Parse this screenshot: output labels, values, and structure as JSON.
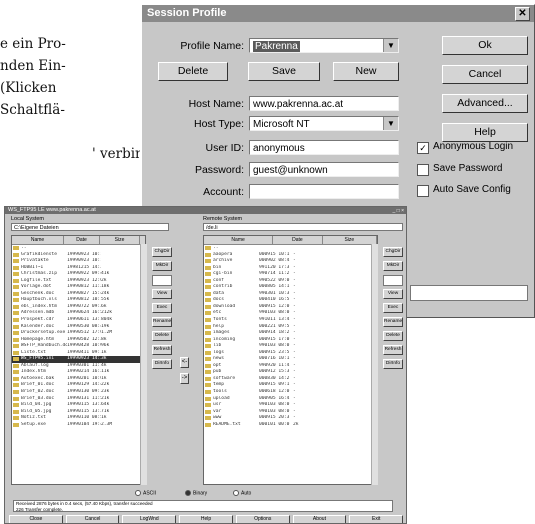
{
  "bg_text": {
    "lines": [
      "e ein Pro-",
      "nden Ein-",
      "(Klicken",
      "Schaltflä-",
      "' verbin-"
    ]
  },
  "session_profile": {
    "title": "Session Profile",
    "close_glyph": "✕",
    "profile_name": {
      "label": "Profile Name:",
      "value": "Pakrenna"
    },
    "delete_label": "Delete",
    "save_label": "Save",
    "new_label": "New",
    "host_name": {
      "label": "Host Name:",
      "value": "www.pakrenna.ac.at"
    },
    "host_type": {
      "label": "Host Type:",
      "value": "Microsoft NT"
    },
    "user_id": {
      "label": "User ID:",
      "value": "anonymous"
    },
    "password": {
      "label": "Password:",
      "value": "guest@unknown"
    },
    "account": {
      "label": "Account:",
      "value": ""
    },
    "ok_label": "Ok",
    "cancel_label": "Cancel",
    "advanced_label": "Advanced...",
    "help_label": "Help",
    "anon_login": {
      "label": "Anonymous Login",
      "checked": true
    },
    "save_password": {
      "label": "Save Password",
      "checked": false
    },
    "auto_save": {
      "label": "Auto Save Config",
      "checked": false
    }
  },
  "ftp": {
    "title": "WS_FTP95 LE www.pakrenna.ac.at",
    "window_controls": "_ □ ×",
    "local_label": "Local System",
    "remote_label": "Remote System",
    "local_path": "C:\\Eigene Dateien",
    "remote_path": "/de.li",
    "headers": [
      "Name",
      "Date",
      "Size"
    ],
    "remote_headers": [
      "Name",
      "Date",
      "Size"
    ],
    "local_files": [
      [
        "..",
        "",
        ""
      ],
      [
        "Grafikdienste",
        "19990923 10:12",
        ""
      ],
      [
        "Privatakte",
        "19990923 10:14",
        ""
      ],
      [
        "HOBBIT~1",
        "19981215 14:33",
        ""
      ],
      [
        "Christmas.zip",
        "19990922 09:45",
        "41k"
      ],
      [
        "Logfile.txt",
        "19990923 12:02",
        "2k"
      ],
      [
        "Vorlage.dot",
        "19990812 11:20",
        "18k"
      ],
      [
        "Geschenk.doc",
        "19990827 15:44",
        "24k"
      ],
      [
        "Hauptbuch.xls",
        "19990812 10:18",
        "55k"
      ],
      [
        "ebl_index.htm",
        "19990722 09:31",
        "6k"
      ],
      [
        "Adressen.mdb",
        "19990624 16:50",
        "212k"
      ],
      [
        "Prospekt.cdr",
        "19990611 13:12",
        "804k"
      ],
      [
        "Kalender.doc",
        "19990530 08:44",
        "19k"
      ],
      [
        "Druckersetup.exe",
        "19990512 17:01",
        "1.2M"
      ],
      [
        "Homepage.htm",
        "19990502 12:33",
        "8k"
      ],
      [
        "WSFTP_Handbuch.doc",
        "19990428 10:05",
        "96k"
      ],
      [
        "Liste.txt",
        "19990411 09:12",
        "1k"
      ],
      [
        "WS_FTP95.ini",
        "19990923 14:22",
        "3k"
      ],
      [
        "Ablauf.log",
        "19990301 11:11",
        "4k"
      ],
      [
        "Index.htm",
        "19990214 16:29",
        "11k"
      ],
      [
        "Autoexec.bak",
        "19990201 10:00",
        "1k"
      ],
      [
        "Brief_01.doc",
        "19990129 14:45",
        "22k"
      ],
      [
        "Brief_02.doc",
        "19990130 09:18",
        "23k"
      ],
      [
        "Brief_03.doc",
        "19990131 11:50",
        "21k"
      ],
      [
        "Bild_04.jpg",
        "19990115 13:20",
        "64k"
      ],
      [
        "Bild_05.jpg",
        "19990115 13:24",
        "71k"
      ],
      [
        "Notiz.txt",
        "19990110 08:55",
        "1k"
      ],
      [
        "Setup.exe",
        "19990104 19:42",
        "2.3M"
      ]
    ],
    "local_highlight": 17,
    "remote_files": [
      [
        "..",
        "",
        ""
      ],
      [
        "aaopera",
        "000915 10:1",
        "-"
      ],
      [
        "archive",
        "000902 08:4",
        "-"
      ],
      [
        "bin",
        "991120 17:3",
        "-"
      ],
      [
        "cgi-bin",
        "990714 11:2",
        "-"
      ],
      [
        "conf",
        "990522 09:0",
        "-"
      ],
      [
        "contrib",
        "000805 14:1",
        "-"
      ],
      [
        "data",
        "990301 10:3",
        "-"
      ],
      [
        "docs",
        "000410 16:5",
        "-"
      ],
      [
        "download",
        "000915 12:0",
        "-"
      ],
      [
        "etc",
        "990103 08:0",
        "-"
      ],
      [
        "fonts",
        "991011 13:4",
        "-"
      ],
      [
        "help",
        "000221 09:5",
        "-"
      ],
      [
        "images",
        "000914 18:2",
        "-"
      ],
      [
        "incoming",
        "000915 17:0",
        "-"
      ],
      [
        "lib",
        "990103 08:0",
        "-"
      ],
      [
        "logs",
        "000915 23:5",
        "-"
      ],
      [
        "news",
        "000716 10:1",
        "-"
      ],
      [
        "opt",
        "990920 11:4",
        "-"
      ],
      [
        "pub",
        "000912 15:3",
        "-"
      ],
      [
        "software",
        "000830 14:2",
        "-"
      ],
      [
        "temp",
        "000915 09:1",
        "-"
      ],
      [
        "tools",
        "000618 12:0",
        "-"
      ],
      [
        "upload",
        "000905 16:4",
        "-"
      ],
      [
        "usr",
        "990103 08:0",
        "-"
      ],
      [
        "var",
        "990103 08:0",
        "-"
      ],
      [
        "www",
        "000915 20:3",
        "-"
      ],
      [
        "README.txt",
        "000101 00:0",
        "2k"
      ]
    ],
    "local_buttons": [
      "ChgDir",
      "MkDir",
      "",
      "View",
      "Exec",
      "Rename",
      "Delete",
      "Refresh",
      "DirInfo"
    ],
    "remote_buttons": [
      "ChgDir",
      "MkDir",
      "",
      "View",
      "Exec",
      "Rename",
      "Delete",
      "Refresh",
      "DirInfo"
    ],
    "arrow_left": "<-",
    "arrow_right": "->",
    "mode_ascii": "ASCII",
    "mode_binary": "Binary",
    "mode_auto": "Auto",
    "log_lines": [
      "Received 2876 bytes in 0.4 secs, (57.40 Kbps), transfer succeeded",
      "226 Transfer complete."
    ],
    "bottom_buttons": [
      "Close",
      "Cancel",
      "LogWnd",
      "Help",
      "Options",
      "About",
      "Exit"
    ]
  }
}
